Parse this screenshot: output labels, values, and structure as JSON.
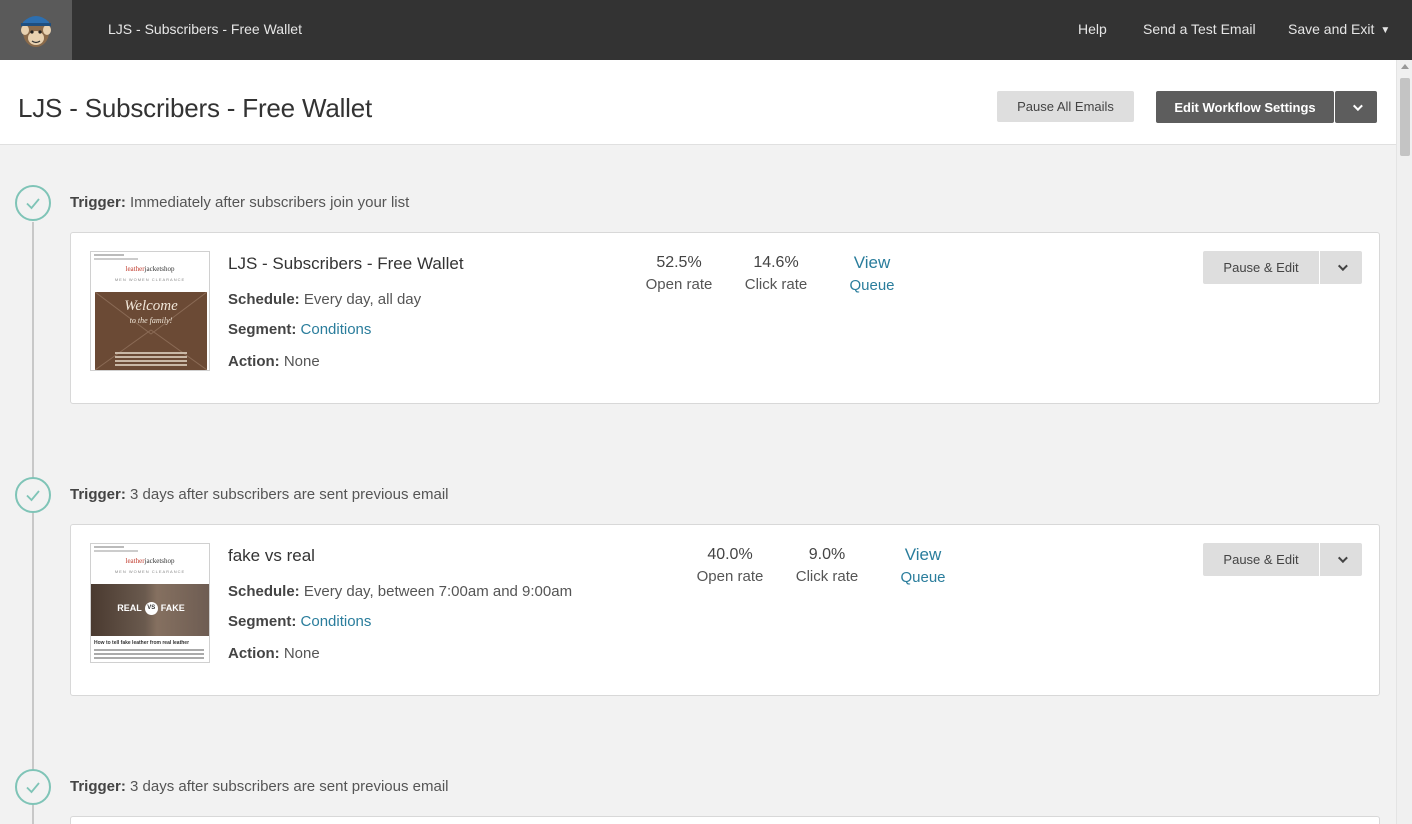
{
  "topbar": {
    "title": "LJS - Subscribers - Free Wallet",
    "help": "Help",
    "send_test": "Send a Test Email",
    "save_exit": "Save and Exit"
  },
  "header": {
    "title": "LJS - Subscribers - Free Wallet",
    "pause_all": "Pause All Emails",
    "edit_workflow": "Edit Workflow Settings"
  },
  "steps": [
    {
      "trigger_label": "Trigger:",
      "trigger_text": "Immediately after subscribers join your list",
      "email": {
        "name": "LJS - Subscribers - Free Wallet",
        "schedule_label": "Schedule:",
        "schedule": "Every day, all day",
        "segment_label": "Segment:",
        "segment": "Conditions",
        "action_label": "Action:",
        "action": "None",
        "open_rate": "52.5%",
        "open_rate_label": "Open rate",
        "click_rate": "14.6%",
        "click_rate_label": "Click rate",
        "view": "View",
        "queue": "Queue",
        "pause_edit": "Pause & Edit",
        "thumb": {
          "brand_a": "leather",
          "brand_b": "jacketshop",
          "nav": "MEN   WOMEN   CLEARANCE",
          "headline": "Welcome",
          "sub": "to the family!"
        }
      }
    },
    {
      "trigger_label": "Trigger:",
      "trigger_text": "3 days after subscribers are sent previous email",
      "email": {
        "name": "fake vs real",
        "schedule_label": "Schedule:",
        "schedule": "Every day, between 7:00am and 9:00am",
        "segment_label": "Segment:",
        "segment": "Conditions",
        "action_label": "Action:",
        "action": "None",
        "open_rate": "40.0%",
        "open_rate_label": "Open rate",
        "click_rate": "9.0%",
        "click_rate_label": "Click rate",
        "view": "View",
        "queue": "Queue",
        "pause_edit": "Pause & Edit",
        "thumb": {
          "brand_a": "leather",
          "brand_b": "jacketshop",
          "nav": "MEN   WOMEN   CLEARANCE",
          "real": "REAL",
          "vs": "VS",
          "fake": "FAKE",
          "title": "How to tell fake leather from real leather"
        }
      }
    },
    {
      "trigger_label": "Trigger:",
      "trigger_text": "3 days after subscribers are sent previous email"
    }
  ],
  "colors": {
    "topbar": "#333333",
    "link": "#2a7d9c",
    "check": "#7fc4b7",
    "dark_button": "#5d5d5d"
  }
}
